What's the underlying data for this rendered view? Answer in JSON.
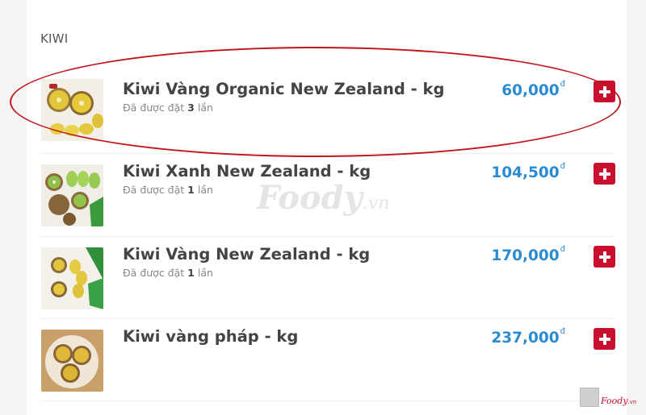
{
  "section": {
    "title": "KIWI"
  },
  "currency_symbol": "đ",
  "items": [
    {
      "name": "Kiwi Vàng Organic New Zealand - kg",
      "ordered_prefix": "Đã được đặt",
      "ordered_count": "3",
      "ordered_suffix": "lần",
      "price": "60,000",
      "image": "golden-kiwi-halves"
    },
    {
      "name": "Kiwi Xanh New Zealand - kg",
      "ordered_prefix": "Đã được đặt",
      "ordered_count": "1",
      "ordered_suffix": "lần",
      "price": "104,500",
      "image": "green-kiwi-slices"
    },
    {
      "name": "Kiwi Vàng New Zealand - kg",
      "ordered_prefix": "Đã được đặt",
      "ordered_count": "1",
      "ordered_suffix": "lần",
      "price": "170,000",
      "image": "golden-kiwi-slices"
    },
    {
      "name": "Kiwi vàng pháp - kg",
      "price": "237,000",
      "image": "golden-kiwi-bowl"
    }
  ],
  "watermark": {
    "brand": "Foody",
    "suffix": ".vn"
  },
  "corner_brand": {
    "brand": "Foody",
    "suffix": ".vn"
  },
  "colors": {
    "price": "#2a8bd1",
    "add_button": "#c8102e",
    "highlight": "#c0151c"
  }
}
